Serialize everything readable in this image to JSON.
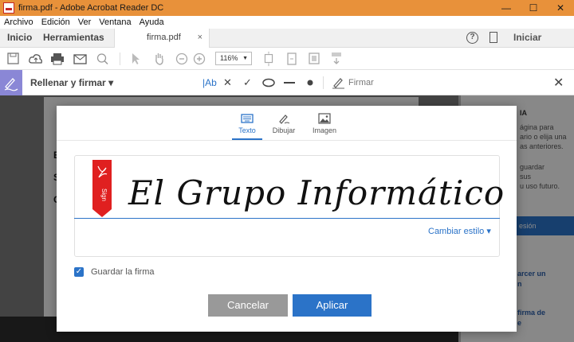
{
  "window": {
    "title": "firma.pdf - Adobe Acrobat Reader DC",
    "minimize": "—",
    "maximize": "☐",
    "close": "✕"
  },
  "menu": [
    "Archivo",
    "Edición",
    "Ver",
    "Ventana",
    "Ayuda"
  ],
  "tabs": {
    "home": "Inicio",
    "tools": "Herramientas",
    "doc": "firma.pdf",
    "doc_close": "×",
    "signin": "Iniciar sesión",
    "help": "?"
  },
  "toolbar": {
    "zoom": "116%"
  },
  "fill_sign": {
    "label": "Rellenar y firmar",
    "text_tool": "Ab",
    "sign_label": "Firmar"
  },
  "background": {
    "doc_letters": [
      "E",
      "S",
      "C"
    ],
    "panel_lines": [
      "IA",
      "ágina para",
      "ario o elija una",
      "as anteriores.",
      "guardar",
      "sus",
      "u uso futuro."
    ],
    "panel_button": "esión",
    "panel_links": [
      "arcer un",
      "n",
      "firma de",
      "e"
    ]
  },
  "dialog": {
    "tabs": [
      {
        "label": "Texto",
        "icon": "keyboard-icon",
        "active": true
      },
      {
        "label": "Dibujar",
        "icon": "pen-draw-icon",
        "active": false
      },
      {
        "label": "Imagen",
        "icon": "image-icon",
        "active": false
      }
    ],
    "ribbon_text": "Sign",
    "signature": "El Grupo Informático",
    "change_style": "Cambiar estilo",
    "save_signature": "Guardar la firma",
    "save_checked": true,
    "cancel": "Cancelar",
    "apply": "Aplicar"
  },
  "colors": {
    "accent": "#2b73c8",
    "titlebar": "#e8913a",
    "fill_sign_icon": "#8a87d6",
    "ribbon": "#e02020"
  }
}
